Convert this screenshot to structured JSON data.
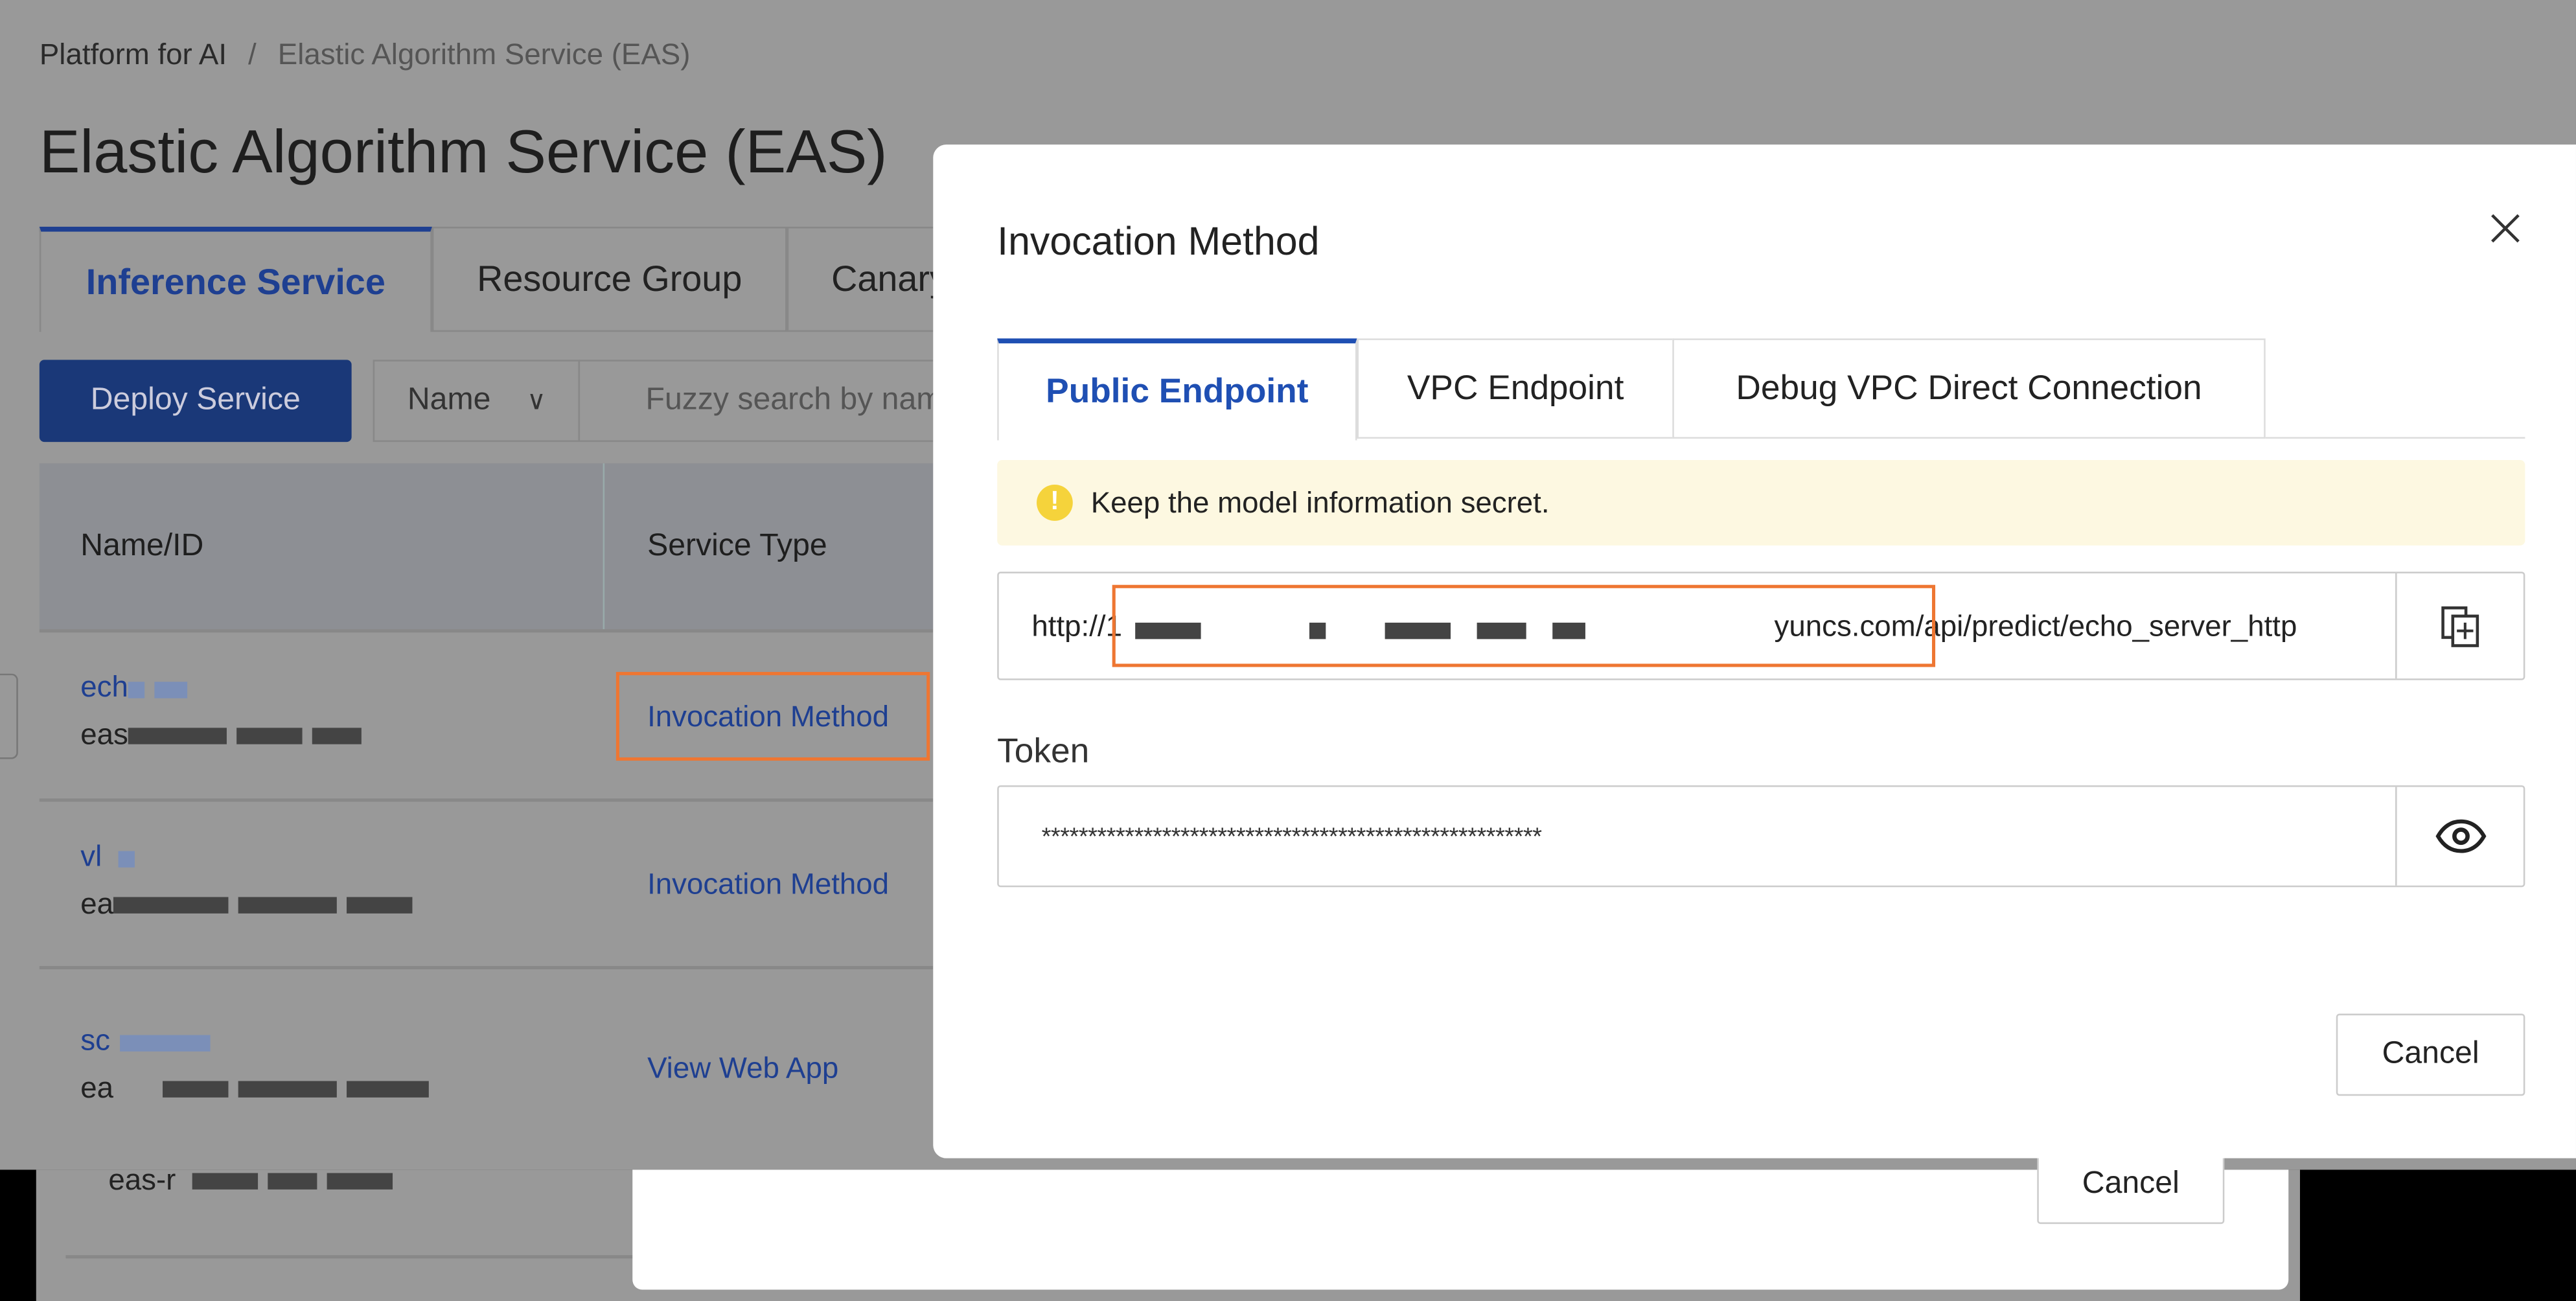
{
  "breadcrumb": {
    "items": [
      "Platform for AI",
      "Elastic Algorithm Service (EAS)"
    ],
    "separator": "/"
  },
  "page_title": "Elastic Algorithm Service (EAS)",
  "tabs": [
    {
      "label": "Inference Service",
      "active": true
    },
    {
      "label": "Resource Group"
    },
    {
      "label": "Canary"
    }
  ],
  "toolbar": {
    "deploy_label": "Deploy Service",
    "filter_select": "Name",
    "search_placeholder": "Fuzzy search by name"
  },
  "table": {
    "columns": [
      "Name/ID",
      "Service Type"
    ],
    "rows": [
      {
        "name": "ech",
        "id": "eas",
        "action": "Invocation Method"
      },
      {
        "name": "vl",
        "id": "ea",
        "action": "Invocation Method"
      },
      {
        "name": "sc",
        "id": "ea",
        "action": "View Web App"
      }
    ],
    "partial_row_id": "eas-r"
  },
  "modal": {
    "title": "Invocation Method",
    "tabs": [
      {
        "label": "Public Endpoint",
        "active": true
      },
      {
        "label": "VPC Endpoint"
      },
      {
        "label": "Debug VPC Direct Connection"
      }
    ],
    "alert": "Keep the model information secret.",
    "endpoint": {
      "prefix": "http://1",
      "suffix": "yuncs.com/api/predict/echo_server_http"
    },
    "token_label": "Token",
    "token_value": "******************************************************",
    "cancel_label": "Cancel"
  },
  "background_modal": {
    "cancel_label": "Cancel"
  },
  "colors": {
    "accent": "#1f4fb3",
    "highlight": "#ee7632",
    "alert_bg": "#fdf8e1",
    "warning_icon": "#f5d33b"
  },
  "icons": {
    "close": "close-icon",
    "copy": "copy-icon",
    "eye": "eye-icon",
    "search": "search-icon",
    "chevron": "chevron-down-icon",
    "warning": "warning-icon"
  }
}
